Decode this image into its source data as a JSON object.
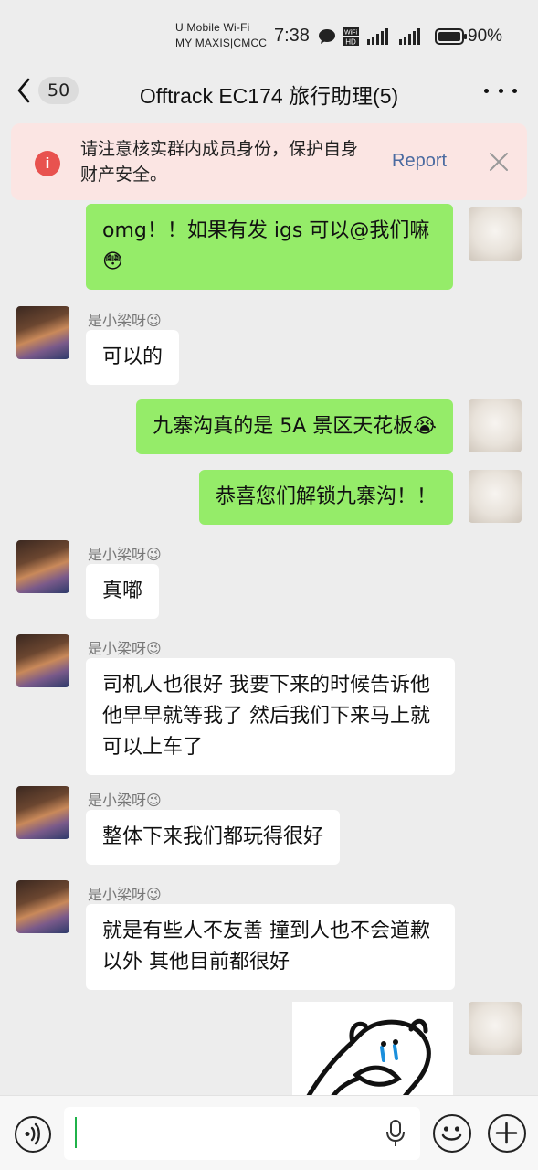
{
  "status_bar": {
    "carrier_line1": "U Mobile Wi-Fi",
    "carrier_line2": "MY MAXIS|CMCC",
    "time": "7:38",
    "battery": "90%"
  },
  "header": {
    "unread_count": "50",
    "title": "Offtrack EC174 旅行助理(5)"
  },
  "warning": {
    "icon_text": "i",
    "text": "请注意核实群内成员身份，保护自身财产安全。",
    "report_label": "Report"
  },
  "messages": [
    {
      "side": "out",
      "text": "omg！！如果有发 igs 可以@我们嘛😳"
    },
    {
      "side": "in",
      "sender": "是小梁呀😉",
      "text": "可以的"
    },
    {
      "side": "out",
      "text": "九寨沟真的是 5A 景区天花板😭"
    },
    {
      "side": "out",
      "text": "恭喜您们解锁九寨沟！！"
    },
    {
      "side": "in",
      "sender": "是小梁呀😉",
      "text": "真嘟"
    },
    {
      "side": "in",
      "sender": "是小梁呀😉",
      "text": "司机人也很好 我要下来的时候告诉他 他早早就等我了 然后我们下来马上就可以上车了"
    },
    {
      "side": "in",
      "sender": "是小梁呀😉",
      "text": "整体下来我们都玩得很好"
    },
    {
      "side": "in",
      "sender": "是小梁呀😉",
      "text": "就是有些人不友善 撞到人也不会道歉以外 其他目前都很好"
    },
    {
      "side": "out",
      "type": "sticker",
      "icon": "crying-cat-sticker"
    }
  ],
  "colors": {
    "background": "#ededed",
    "bubble_out": "#95ec69",
    "bubble_in": "#ffffff",
    "warning_bg": "#fbe5e3",
    "warning_icon": "#e8524f",
    "report_link": "#4a6aa0",
    "caret": "#20b24a"
  },
  "icons": {
    "back": "chevron-left-icon",
    "more": "more-dots-icon",
    "warning": "info-circle-icon",
    "close": "close-icon",
    "voice": "voice-icon",
    "mic": "mic-icon",
    "emoji": "emoji-icon",
    "plus": "plus-icon"
  }
}
